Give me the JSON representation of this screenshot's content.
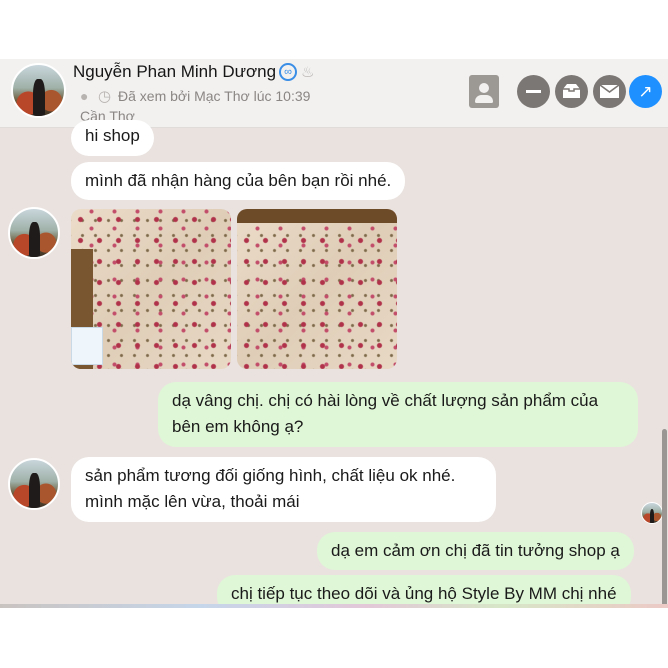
{
  "header": {
    "name": "Nguyễn Phan Minh Dương",
    "verified_icon": "link-badge-icon",
    "cake_icon": "cake-icon",
    "seen_status": "Đã xem bởi Mạc Thơ lúc 10:39",
    "location": "Cần Thơ",
    "buttons": {
      "profile": "profile-card-icon",
      "minimize": "minus-icon",
      "box": "box-icon",
      "mail": "mail-icon",
      "open": "↗"
    }
  },
  "messages": [
    {
      "direction": "in",
      "text": "hi shop"
    },
    {
      "direction": "in",
      "text": "mình đã nhận hàng của bên bạn rồi nhé."
    },
    {
      "direction": "in",
      "type": "images",
      "count": 2
    },
    {
      "direction": "out",
      "lines": [
        "dạ vâng chị. chị có hài lòng về chất lượng sản phẩm của",
        "bên em không ạ?"
      ]
    },
    {
      "direction": "in",
      "lines": [
        "sản phẩm tương đối giống hình, chất liệu ok nhé.",
        "mình mặc lên vừa, thoải mái"
      ]
    },
    {
      "direction": "out",
      "text": "dạ em cảm ơn chị đã tin tưởng shop ạ"
    },
    {
      "direction": "out",
      "text": "chị tiếp tục theo dõi và ủng hộ Style By MM chị nhé"
    }
  ],
  "colors": {
    "chat_background": "#e9e2df",
    "incoming_bubble": "#ffffff",
    "outgoing_bubble": "#dff7d6",
    "accent_button": "#1e90ff"
  }
}
